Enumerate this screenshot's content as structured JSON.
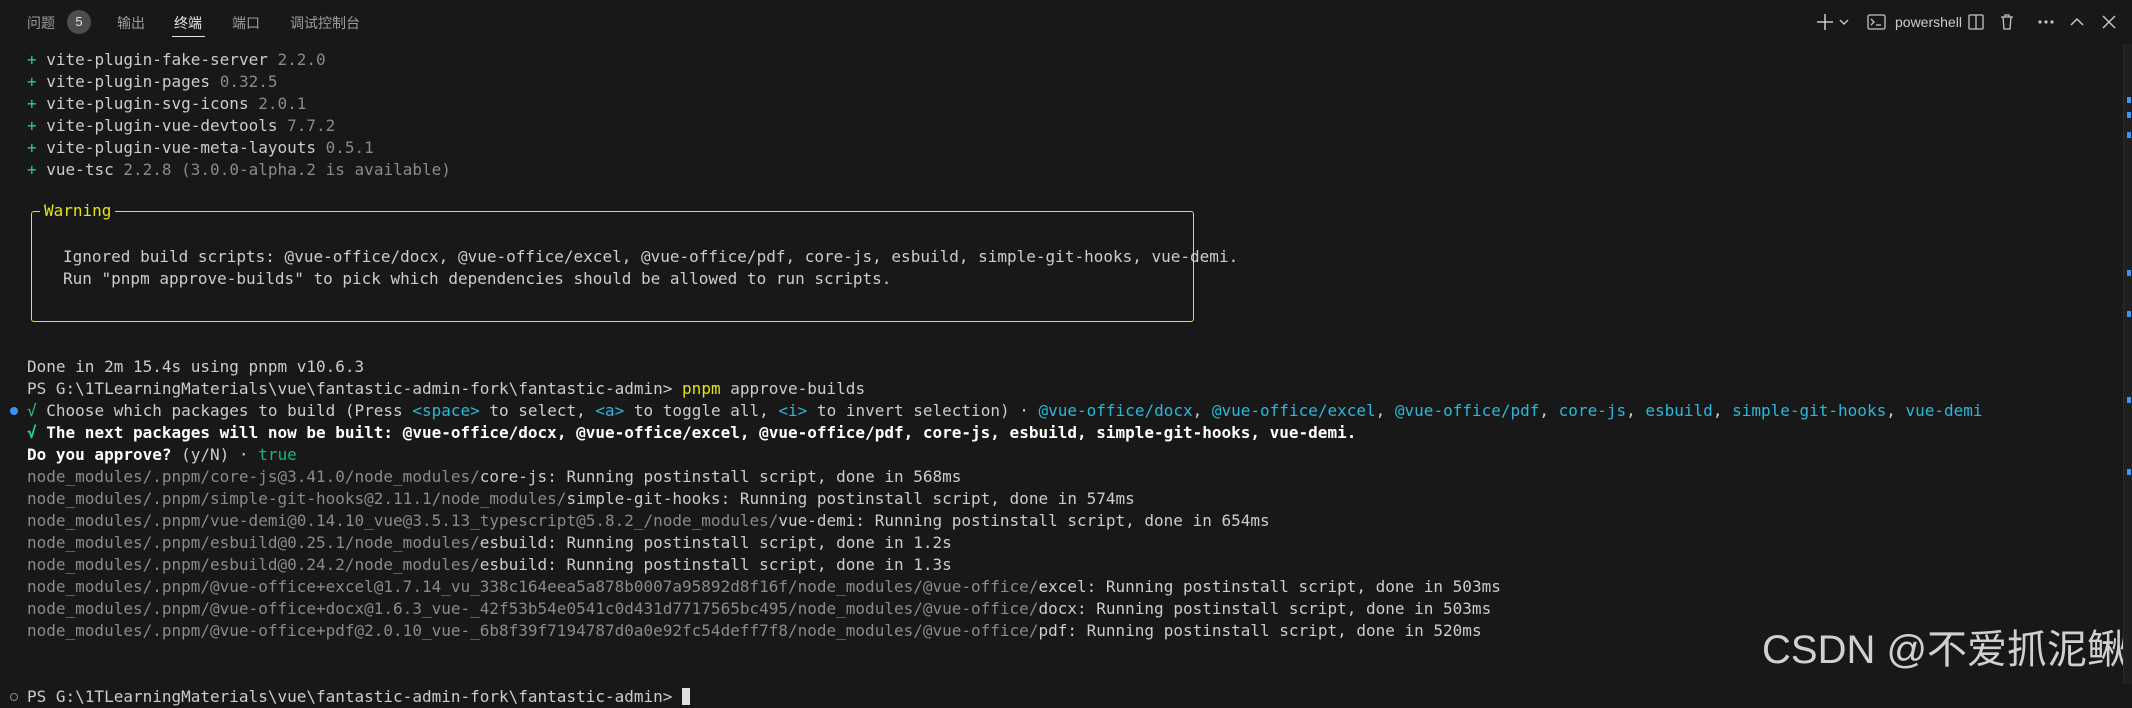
{
  "tabs": {
    "problems": "问题",
    "problems_count": "5",
    "output": "输出",
    "terminal": "终端",
    "ports": "端口",
    "debug_console": "调试控制台"
  },
  "toolbar": {
    "shell_name": "powershell",
    "icons": [
      "plus-icon",
      "chevron-down-icon",
      "terminal-icon",
      "split-icon",
      "trash-icon",
      "more-icon",
      "chevron-up-icon",
      "close-icon"
    ]
  },
  "terminal": {
    "deps": [
      {
        "name": "vite-plugin-fake-server",
        "version": "2.2.0"
      },
      {
        "name": "vite-plugin-pages",
        "version": "0.32.5"
      },
      {
        "name": "vite-plugin-svg-icons",
        "version": "2.0.1"
      },
      {
        "name": "vite-plugin-vue-devtools",
        "version": "7.7.2"
      },
      {
        "name": "vite-plugin-vue-meta-layouts",
        "version": "0.5.1"
      },
      {
        "name": "vue-tsc",
        "version": "2.2.8 (3.0.0-alpha.2 is available)"
      }
    ],
    "warning": {
      "title": "Warning",
      "line1": "Ignored build scripts: @vue-office/docx, @vue-office/excel, @vue-office/pdf, core-js, esbuild, simple-git-hooks, vue-demi.",
      "line2": "Run \"pnpm approve-builds\" to pick which dependencies should be allowed to run scripts."
    },
    "done": "Done in 2m 15.4s using pnpm v10.6.3",
    "prompt": "PS G:\\1TLearningMaterials\\vue\\fantastic-admin-fork\\fantastic-admin>",
    "command_bin": "pnpm",
    "command_args": " approve-builds",
    "choose": {
      "check": "√",
      "text1": " Choose which packages to build (Press ",
      "k_space": "<space>",
      "text2": " to select, ",
      "k_a": "<a>",
      "text3": " to toggle all, ",
      "k_i": "<i>",
      "text4": " to invert selection) · ",
      "packages": [
        "@vue-office/docx",
        "@vue-office/excel",
        "@vue-office/pdf",
        "core-js",
        "esbuild",
        "simple-git-hooks",
        "vue-demi"
      ]
    },
    "next": {
      "check": "√",
      "text": " The next packages will now be built: @vue-office/docx, @vue-office/excel, @vue-office/pdf, core-js, esbuild, simple-git-hooks, vue-demi."
    },
    "approve": {
      "question": "Do you approve?",
      "hint": " (y/N)",
      "sep": " · ",
      "answer": "true"
    },
    "postinstall": [
      {
        "path": "node_modules/.pnpm/core-js@3.41.0/node_modules/",
        "pkg": "core-js",
        "msg": ": Running postinstall script, done in 568ms"
      },
      {
        "path": "node_modules/.pnpm/simple-git-hooks@2.11.1/node_modules/",
        "pkg": "simple-git-hooks",
        "msg": ": Running postinstall script, done in 574ms"
      },
      {
        "path": "node_modules/.pnpm/vue-demi@0.14.10_vue@3.5.13_typescript@5.8.2_/node_modules/",
        "pkg": "vue-demi",
        "msg": ": Running postinstall script, done in 654ms"
      },
      {
        "path": "node_modules/.pnpm/esbuild@0.25.1/node_modules/",
        "pkg": "esbuild",
        "msg": ": Running postinstall script, done in 1.2s"
      },
      {
        "path": "node_modules/.pnpm/esbuild@0.24.2/node_modules/",
        "pkg": "esbuild",
        "msg": ": Running postinstall script, done in 1.3s"
      },
      {
        "path": "node_modules/.pnpm/@vue-office+excel@1.7.14_vu_338c164eea5a878b0007a95892d8f16f/node_modules/@vue-office/",
        "pkg": "excel",
        "msg": ": Running postinstall script, done in 503ms"
      },
      {
        "path": "node_modules/.pnpm/@vue-office+docx@1.6.3_vue-_42f53b54e0541c0d431d7717565bc495/node_modules/@vue-office/",
        "pkg": "docx",
        "msg": ": Running postinstall script, done in 503ms"
      },
      {
        "path": "node_modules/.pnpm/@vue-office+pdf@2.0.10_vue-_6b8f39f7194787d0a0e92fc54deff7f8/node_modules/@vue-office/",
        "pkg": "pdf",
        "msg": ": Running postinstall script, done in 520ms"
      }
    ]
  },
  "watermark": "CSDN @不爱抓泥鳅",
  "colors": {
    "background": "#181818",
    "green": "#23d18b",
    "yellow": "#e5e510",
    "cyan": "#29b8db",
    "dot_blue": "#3794ff"
  }
}
